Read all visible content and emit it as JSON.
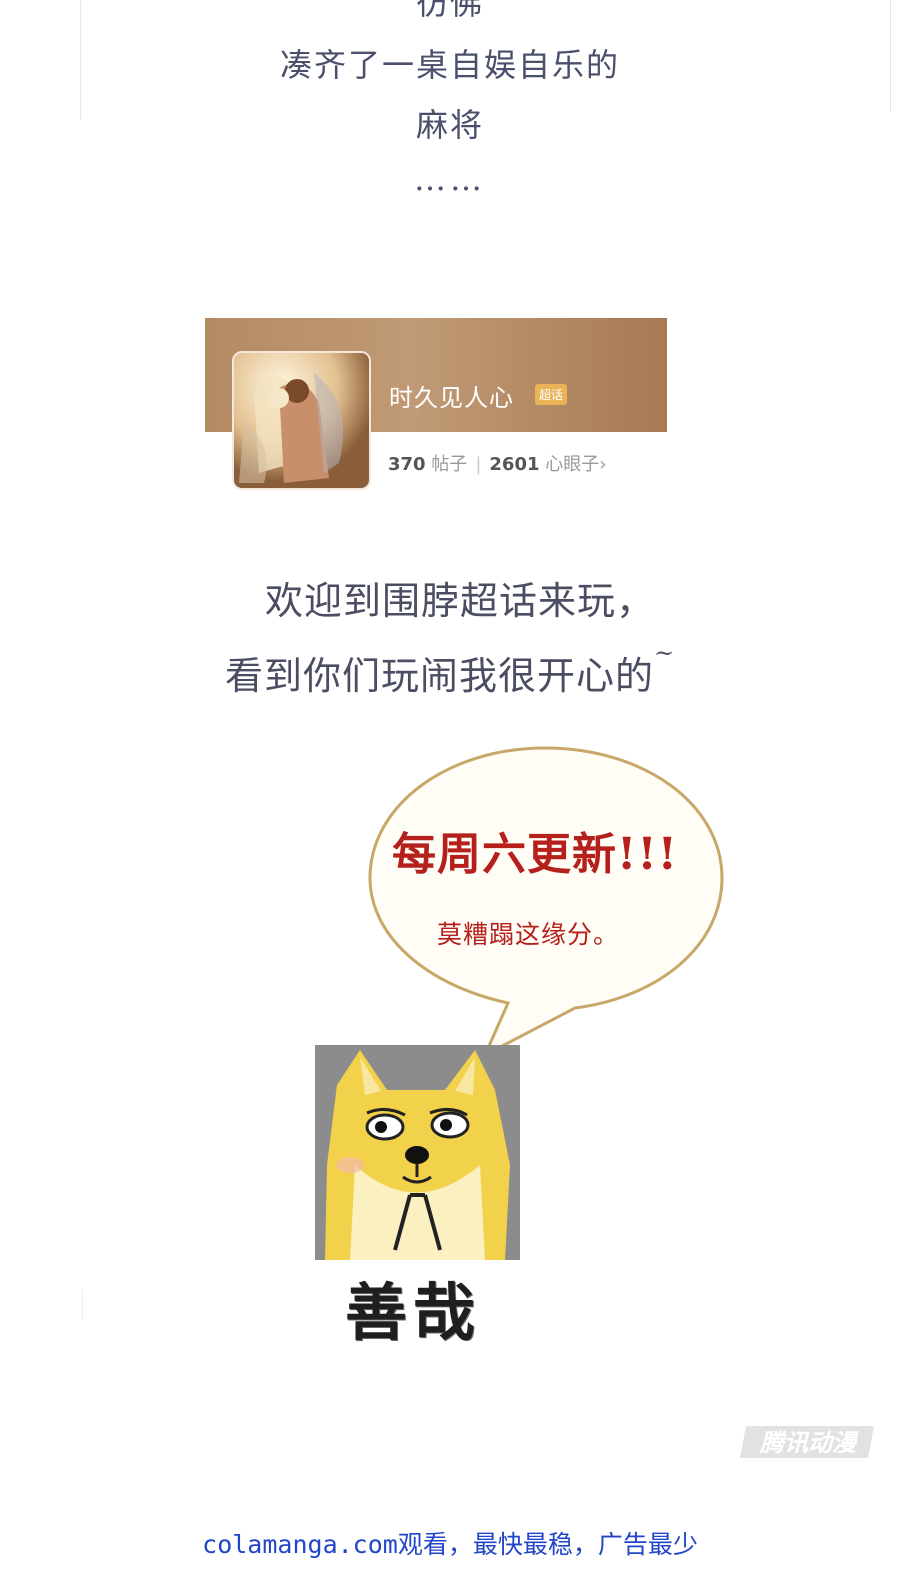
{
  "poem": {
    "line0": "彷佛",
    "line1": "凑齐了一桌自娱自乐的",
    "line2": "麻将",
    "line3": "……"
  },
  "topic_card": {
    "title": "时久见人心",
    "badge": "超话",
    "posts_count": "370",
    "posts_label": "帖子",
    "fans_count": "2601",
    "fans_label": "心眼子",
    "chevron": "›"
  },
  "welcome": {
    "line1": "欢迎到围脖超话来玩，",
    "line2": "看到你们玩闹我很开心的",
    "tilde": "~"
  },
  "bubble": {
    "main": "每周六更新!!!",
    "sub": "莫糟蹋这缘分。"
  },
  "meme": {
    "label": "善哉"
  },
  "watermark": {
    "text": "腾讯动漫"
  },
  "footer": {
    "text": "colamanga.com观看，最快最稳，广告最少"
  },
  "colors": {
    "poem_text": "#4a4f6b",
    "bubble_red": "#b5201c",
    "bubble_border": "#c7a868",
    "footer_blue": "#2346c9"
  }
}
